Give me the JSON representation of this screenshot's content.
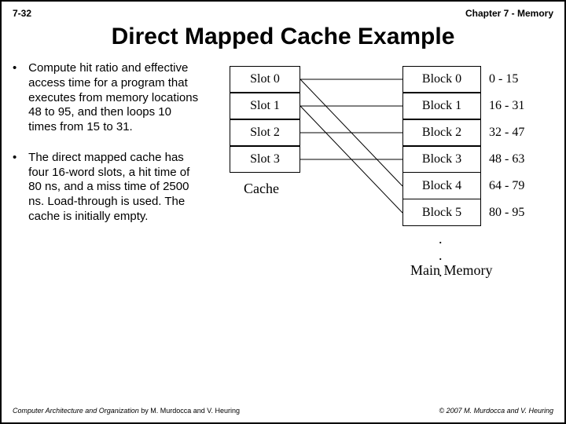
{
  "header": {
    "page_num": "7-32",
    "chapter": "Chapter 7 - Memory"
  },
  "title": "Direct Mapped Cache Example",
  "bullets": [
    "Compute hit ratio and effective access time for a program that executes from memory locations 48 to 95, and then loops 10 times from 15 to 31.",
    "The direct mapped cache has four 16-word slots, a hit time of 80 ns, and a miss time of 2500 ns. Load-through is used. The cache is initially empty."
  ],
  "figure": {
    "slots": [
      "Slot 0",
      "Slot 1",
      "Slot 2",
      "Slot 3"
    ],
    "blocks": [
      "Block 0",
      "Block 1",
      "Block 2",
      "Block 3",
      "Block 4",
      "Block 5"
    ],
    "ranges": [
      "0 - 15",
      "16 - 31",
      "32 - 47",
      "48 - 63",
      "64 - 79",
      "80 - 95"
    ],
    "cache_label": "Cache",
    "mm_label": "Main Memory"
  },
  "footer": {
    "book_title": "Computer Architecture and Organization",
    "authors": "by M. Murdocca and V. Heuring",
    "copyright": "© 2007 M. Murdocca and V. Heuring"
  }
}
